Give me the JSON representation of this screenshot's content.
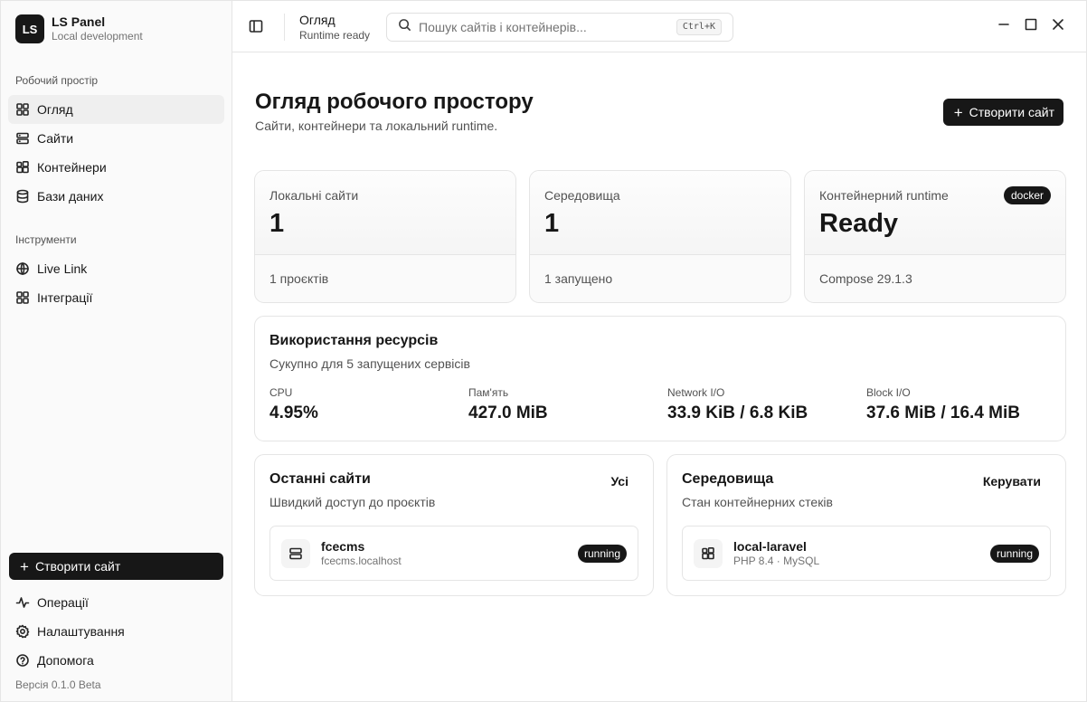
{
  "brand": {
    "logo": "LS",
    "title": "LS Panel",
    "subtitle": "Local development"
  },
  "sidebar": {
    "workspace_label": "Робочий простір",
    "workspace_items": [
      {
        "label": "Огляд",
        "icon": "grid-icon",
        "active": true
      },
      {
        "label": "Сайти",
        "icon": "server-icon"
      },
      {
        "label": "Контейнери",
        "icon": "containers-icon"
      },
      {
        "label": "Бази даних",
        "icon": "database-icon"
      }
    ],
    "tools_label": "Інструменти",
    "tools_items": [
      {
        "label": "Live Link",
        "icon": "globe-icon"
      },
      {
        "label": "Інтеграції",
        "icon": "grid-icon"
      }
    ],
    "create_label": "Створити сайт",
    "bottom_items": [
      {
        "label": "Операції",
        "icon": "activity-icon"
      },
      {
        "label": "Налаштування",
        "icon": "gear-icon"
      },
      {
        "label": "Допомога",
        "icon": "help-icon"
      }
    ],
    "version": "Версія 0.1.0 Beta"
  },
  "topbar": {
    "title": "Огляд",
    "subtitle": "Runtime ready",
    "search_placeholder": "Пошук сайтів і контейнерів...",
    "shortcut": "Ctrl+K"
  },
  "page": {
    "title": "Огляд робочого простору",
    "subtitle": "Сайти, контейнери та локальний runtime.",
    "create_label": "Створити сайт"
  },
  "stats": [
    {
      "label": "Локальні сайти",
      "value": "1",
      "footer": "1 проєктів"
    },
    {
      "label": "Середовища",
      "value": "1",
      "footer": "1 запущено"
    },
    {
      "label": "Контейнерний runtime",
      "value": "Ready",
      "footer": "Compose 29.1.3",
      "badge": "docker"
    }
  ],
  "resources": {
    "title": "Використання ресурсів",
    "subtitle": "Сукупно для 5 запущених сервісів",
    "metrics": [
      {
        "label": "CPU",
        "value": "4.95%"
      },
      {
        "label": "Пам'ять",
        "value": "427.0 MiB"
      },
      {
        "label": "Network I/O",
        "value": "33.9 KiB / 6.8 KiB"
      },
      {
        "label": "Block I/O",
        "value": "37.6 MiB / 16.4 MiB"
      }
    ]
  },
  "recent_sites": {
    "title": "Останні сайти",
    "subtitle": "Швидкий доступ до проєктів",
    "action": "Усі",
    "items": [
      {
        "name": "fcecms",
        "meta": "fcecms.localhost",
        "status": "running"
      }
    ]
  },
  "environments": {
    "title": "Середовища",
    "subtitle": "Стан контейнерних стеків",
    "action": "Керувати",
    "items": [
      {
        "name": "local-laravel",
        "meta": "PHP 8.4 · MySQL",
        "status": "running"
      }
    ]
  }
}
